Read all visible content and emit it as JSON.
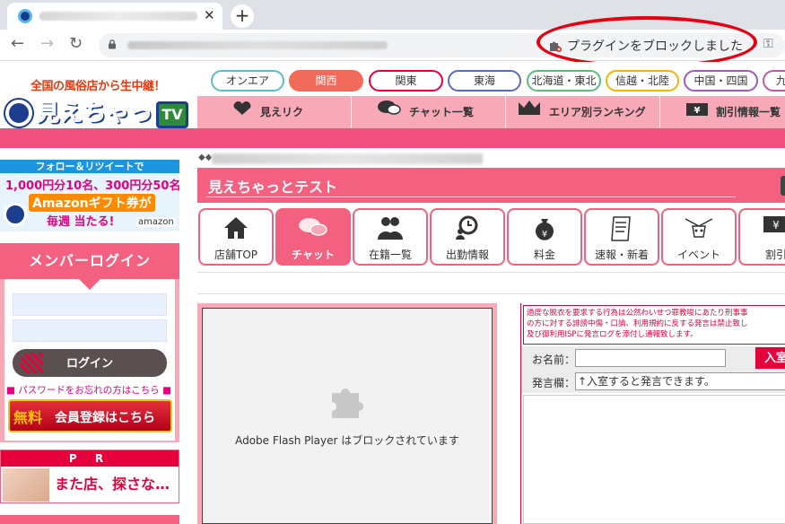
{
  "browser": {
    "new_tab_symbol": "+",
    "close_symbol": "✕",
    "nav": {
      "back": "←",
      "forward": "→",
      "reload": "↻"
    },
    "plugin_notice": "プラグインをブロックしました",
    "key_symbol": "⚿",
    "highlight_color": "#e60012"
  },
  "site": {
    "logo": {
      "tagline": "全国の風俗店から生中継！",
      "name": "見えちゃっと",
      "tv": "TV"
    },
    "regions": [
      {
        "label": "オンエア",
        "color": "#5bbdc4",
        "active": false
      },
      {
        "label": "関西",
        "color": "#f26b5a",
        "active": true
      },
      {
        "label": "関東",
        "color": "#e6003c",
        "active": false
      },
      {
        "label": "東海",
        "color": "#5a6bbd",
        "active": false
      },
      {
        "label": "北海道・東北",
        "color": "#5bbd7a",
        "active": false
      },
      {
        "label": "信越・北陸",
        "color": "#f4b400",
        "active": false
      },
      {
        "label": "中国・四国",
        "color": "#a05bbd",
        "active": false
      },
      {
        "label": "九",
        "color": "#bd5ba0",
        "active": false
      }
    ],
    "menu": [
      {
        "label": "見えリク",
        "icon": "heart-hand-icon"
      },
      {
        "label": "チャット一覧",
        "icon": "chat-bubbles-icon"
      },
      {
        "label": "エリア別ランキング",
        "icon": "crown-icon"
      },
      {
        "label": "割引情報一覧",
        "icon": "yen-ticket-icon"
      }
    ],
    "brand_pink": "#f4607f",
    "light_pink": "#f7a9b7"
  },
  "left": {
    "twitter_banner": {
      "line1": "フォロー＆リツイートで",
      "line2": "1,000円分10名、300円分50名",
      "line3": "Amazonギフト券が",
      "line4": "毎週 当たる!",
      "brand": "amazon"
    },
    "login": {
      "title": "メンバーログイン",
      "button": "ログイン",
      "forgot": "■ パスワードをお忘れの方はこちら ■",
      "register_free": "無料",
      "register_text": "会員登録はこちら"
    },
    "pr": {
      "title": "P R",
      "text": "また店、探さな…"
    }
  },
  "shop": {
    "title": "見えちゃっとテスト",
    "tabs": [
      {
        "label": "店舗TOP",
        "icon": "house-icon",
        "active": false
      },
      {
        "label": "チャット",
        "icon": "chat-bubbles-icon",
        "active": true
      },
      {
        "label": "在籍一覧",
        "icon": "people-icon",
        "active": false
      },
      {
        "label": "出勤情報",
        "icon": "clock-person-icon",
        "active": false
      },
      {
        "label": "料金",
        "icon": "money-bag-icon",
        "active": false
      },
      {
        "label": "速報・新着",
        "icon": "memo-icon",
        "active": false
      },
      {
        "label": "イベント",
        "icon": "party-icon",
        "active": false
      },
      {
        "label": "割引",
        "icon": "yen-ticket-icon",
        "active": false
      }
    ]
  },
  "flash": {
    "message": "Adobe Flash Player はブロックされています"
  },
  "chat": {
    "warning_lines": [
      "過度な脱衣を要求する行為は公然わいせつ罪教唆にあたり刑事事",
      "の方に対する誹謗中傷・口論、利用規約に反する発言は禁止致し",
      "及び御利用ISPに発言ログを添付し通報致します。"
    ],
    "name_label": "お名前：",
    "enter_button": "入室",
    "message_label": "発言欄：",
    "message_value": "↑入室すると発言できます。"
  }
}
